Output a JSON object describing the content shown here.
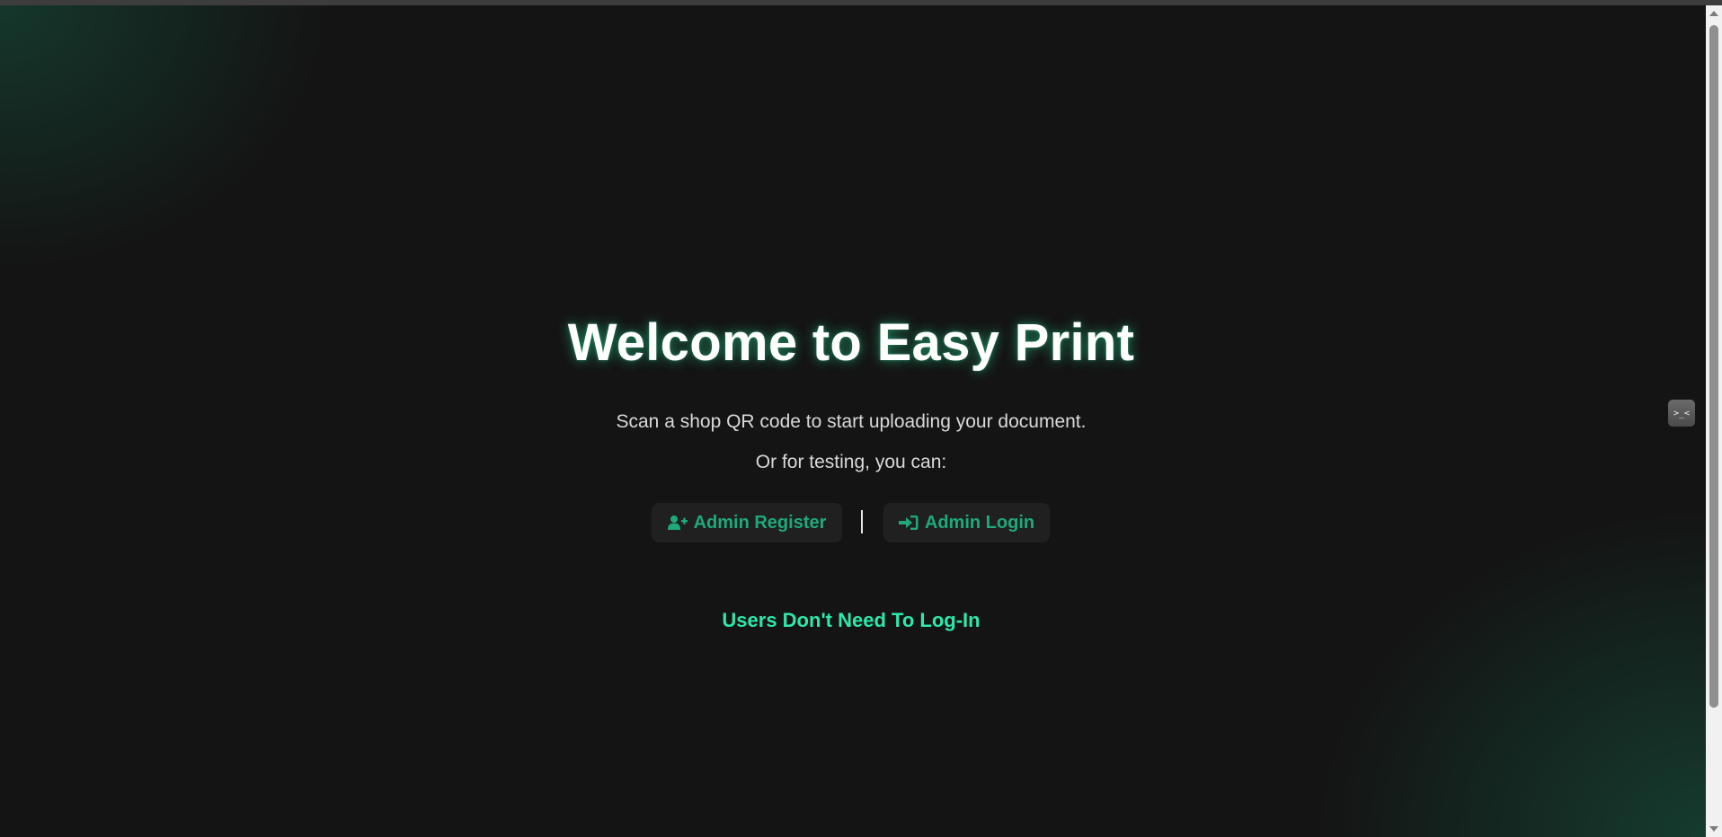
{
  "hero": {
    "title": "Welcome to Easy Print",
    "subtitle": "Scan a shop QR code to start uploading your document.",
    "testing_text": "Or for testing, you can:"
  },
  "actions": {
    "register": {
      "label": "Admin Register",
      "icon": "user-plus-icon"
    },
    "login": {
      "label": "Admin Login",
      "icon": "sign-in-icon"
    }
  },
  "note": "Users Don't Need To Log-In",
  "side_widget": {
    "glyph": ">_<",
    "icon": "face-icon"
  },
  "colors": {
    "background": "#141414",
    "accent": "#1fa97a",
    "note": "#2ee8a8",
    "glow": "#28dc96",
    "text": "#ffffff"
  }
}
